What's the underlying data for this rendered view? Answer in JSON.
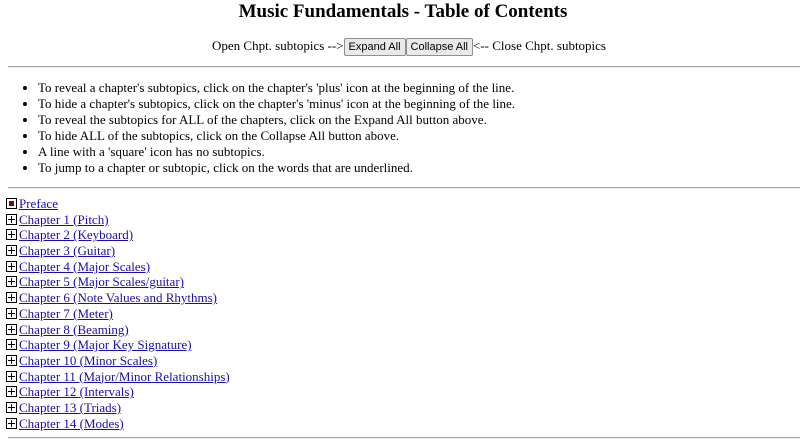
{
  "page": {
    "title": "Music Fundamentals - Table of Contents"
  },
  "controls": {
    "open_label": "Open Chpt. subtopics -->",
    "expand_label": "Expand All",
    "collapse_label": "Collapse All",
    "close_label": "<-- Close Chpt. subtopics"
  },
  "instructions": [
    "To reveal a chapter's subtopics, click on the chapter's 'plus' icon at the beginning of the line.",
    "To hide a chapter's subtopics, click on the chapter's 'minus' icon at the beginning of the line.",
    "To reveal the subtopics for ALL of the chapters, click on the Expand All button above.",
    "To hide ALL of the subtopics, click on the Collapse All button above.",
    "A line with a 'square' icon has no subtopics.",
    "To jump to a chapter or subtopic, click on the words that are underlined."
  ],
  "toc": [
    {
      "label": "Preface",
      "icon": "square-icon"
    },
    {
      "label": "Chapter 1 (Pitch)",
      "icon": "plus-icon"
    },
    {
      "label": "Chapter 2 (Keyboard)",
      "icon": "plus-icon"
    },
    {
      "label": "Chapter 3 (Guitar)",
      "icon": "plus-icon"
    },
    {
      "label": "Chapter 4 (Major Scales)",
      "icon": "plus-icon"
    },
    {
      "label": "Chapter 5 (Major Scales/guitar)",
      "icon": "plus-icon"
    },
    {
      "label": "Chapter 6 (Note Values and Rhythms)",
      "icon": "plus-icon"
    },
    {
      "label": "Chapter 7 (Meter)",
      "icon": "plus-icon"
    },
    {
      "label": "Chapter 8 (Beaming)",
      "icon": "plus-icon"
    },
    {
      "label": "Chapter 9 (Major Key Signature)",
      "icon": "plus-icon"
    },
    {
      "label": "Chapter 10 (Minor Scales)",
      "icon": "plus-icon"
    },
    {
      "label": "Chapter 11 (Major/Minor Relationships)",
      "icon": "plus-icon"
    },
    {
      "label": "Chapter 12 (Intervals)",
      "icon": "plus-icon"
    },
    {
      "label": "Chapter 13 (Triads)",
      "icon": "plus-icon"
    },
    {
      "label": "Chapter 14 (Modes)",
      "icon": "plus-icon"
    }
  ],
  "colors": {
    "link": "#1a0dab",
    "square_fill": "#8b0000"
  }
}
